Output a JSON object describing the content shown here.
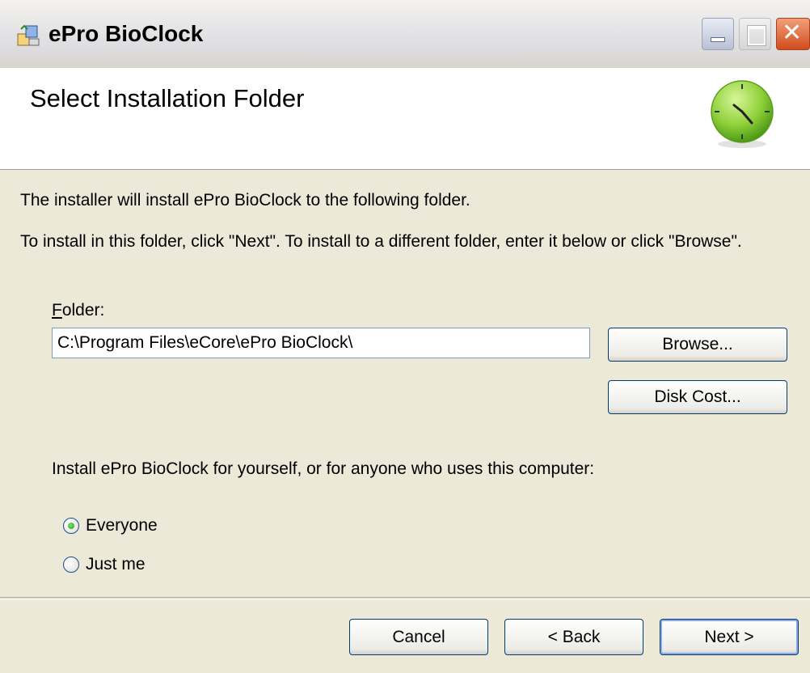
{
  "window": {
    "title": "ePro BioClock",
    "icon": "installer-icon",
    "controls": {
      "minimize": "minimize",
      "maximize": "maximize",
      "close": "close"
    }
  },
  "banner": {
    "title": "Select Installation Folder",
    "icon": "clock-icon"
  },
  "body": {
    "line1": "The installer will install ePro BioClock to the following folder.",
    "line2": "To install in this folder, click \"Next\". To install to a different folder, enter it below or click \"Browse\".",
    "folder_label_first": "F",
    "folder_label_rest": "older:",
    "folder_value": "C:\\Program Files\\eCore\\ePro BioClock\\",
    "browse_label": "Browse...",
    "disk_cost_label": "Disk Cost...",
    "install_for": "Install ePro BioClock for yourself, or for anyone who uses this computer:",
    "options": [
      {
        "label": "Everyone",
        "selected": true
      },
      {
        "label": "Just me",
        "selected": false
      }
    ]
  },
  "footer": {
    "cancel": "Cancel",
    "back": "< Back",
    "next": "Next >"
  }
}
